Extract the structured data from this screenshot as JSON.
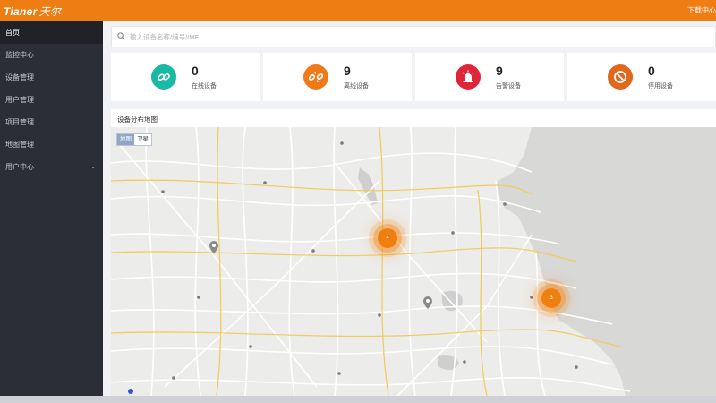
{
  "header": {
    "logo_latin": "Tianer",
    "logo_cn": "天尔",
    "right_link": "下载中心"
  },
  "sidebar": {
    "items": [
      {
        "label": "首页",
        "active": true
      },
      {
        "label": "监控中心",
        "active": false
      },
      {
        "label": "设备管理",
        "active": false
      },
      {
        "label": "用户管理",
        "active": false
      },
      {
        "label": "项目管理",
        "active": false
      },
      {
        "label": "地图管理",
        "active": false
      },
      {
        "label": "用户中心",
        "active": false,
        "has_children": true
      }
    ]
  },
  "search": {
    "placeholder": "输入设备名称/编号/IMEI",
    "value": ""
  },
  "stats": [
    {
      "value": "0",
      "label": "在线设备",
      "color": "#19b9a4",
      "icon": "link-icon"
    },
    {
      "value": "9",
      "label": "离线设备",
      "color": "#ef7a1a",
      "icon": "broken-link-icon"
    },
    {
      "value": "9",
      "label": "告警设备",
      "color": "#e0243a",
      "icon": "alarm-light-icon"
    },
    {
      "value": "0",
      "label": "停用设备",
      "color": "#e0671c",
      "icon": "ban-icon"
    }
  ],
  "map": {
    "title": "设备分布地图",
    "toggle": [
      "地图",
      "卫星"
    ],
    "clusters": [
      "4",
      "3"
    ],
    "pins": 2,
    "colors": {
      "land": "#ececea",
      "sea": "#d8d8d6",
      "road": "#ffffff",
      "highway": "#f2cc63",
      "lake": "#cfcfcf"
    }
  }
}
